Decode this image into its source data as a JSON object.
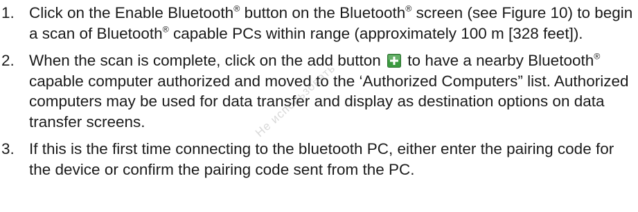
{
  "steps": [
    {
      "number": "1.",
      "segments": [
        {
          "text": "Click on the Enable Bluetooth"
        },
        {
          "sup": "®"
        },
        {
          "text": " button on the Bluetooth"
        },
        {
          "sup": "®"
        },
        {
          "text": " screen (see Figure 10) to begin a scan of Bluetooth"
        },
        {
          "sup": "®"
        },
        {
          "text": " capable PCs within range (approximately 100 m [328 feet])."
        }
      ]
    },
    {
      "number": "2.",
      "segments": [
        {
          "text": "When the scan is complete, click on the add button "
        },
        {
          "icon": "add-button-icon"
        },
        {
          "text": " to have a nearby Bluetooth"
        },
        {
          "sup": "®"
        },
        {
          "text": " capable computer authorized and moved to the ‘Authorized Computers” list. Authorized computers may be used for data transfer and display as destination options on data transfer screens."
        }
      ]
    },
    {
      "number": "3.",
      "segments": [
        {
          "text": "If this is the first time connecting to the bluetooth PC, either enter the pairing code for the device or confirm the pairing code sent from the PC."
        }
      ]
    }
  ],
  "watermark": "Не использовать",
  "colors": {
    "text": "#1a1a1a",
    "icon_fill": "#3b9a3f",
    "icon_border": "#2c6e2f"
  }
}
